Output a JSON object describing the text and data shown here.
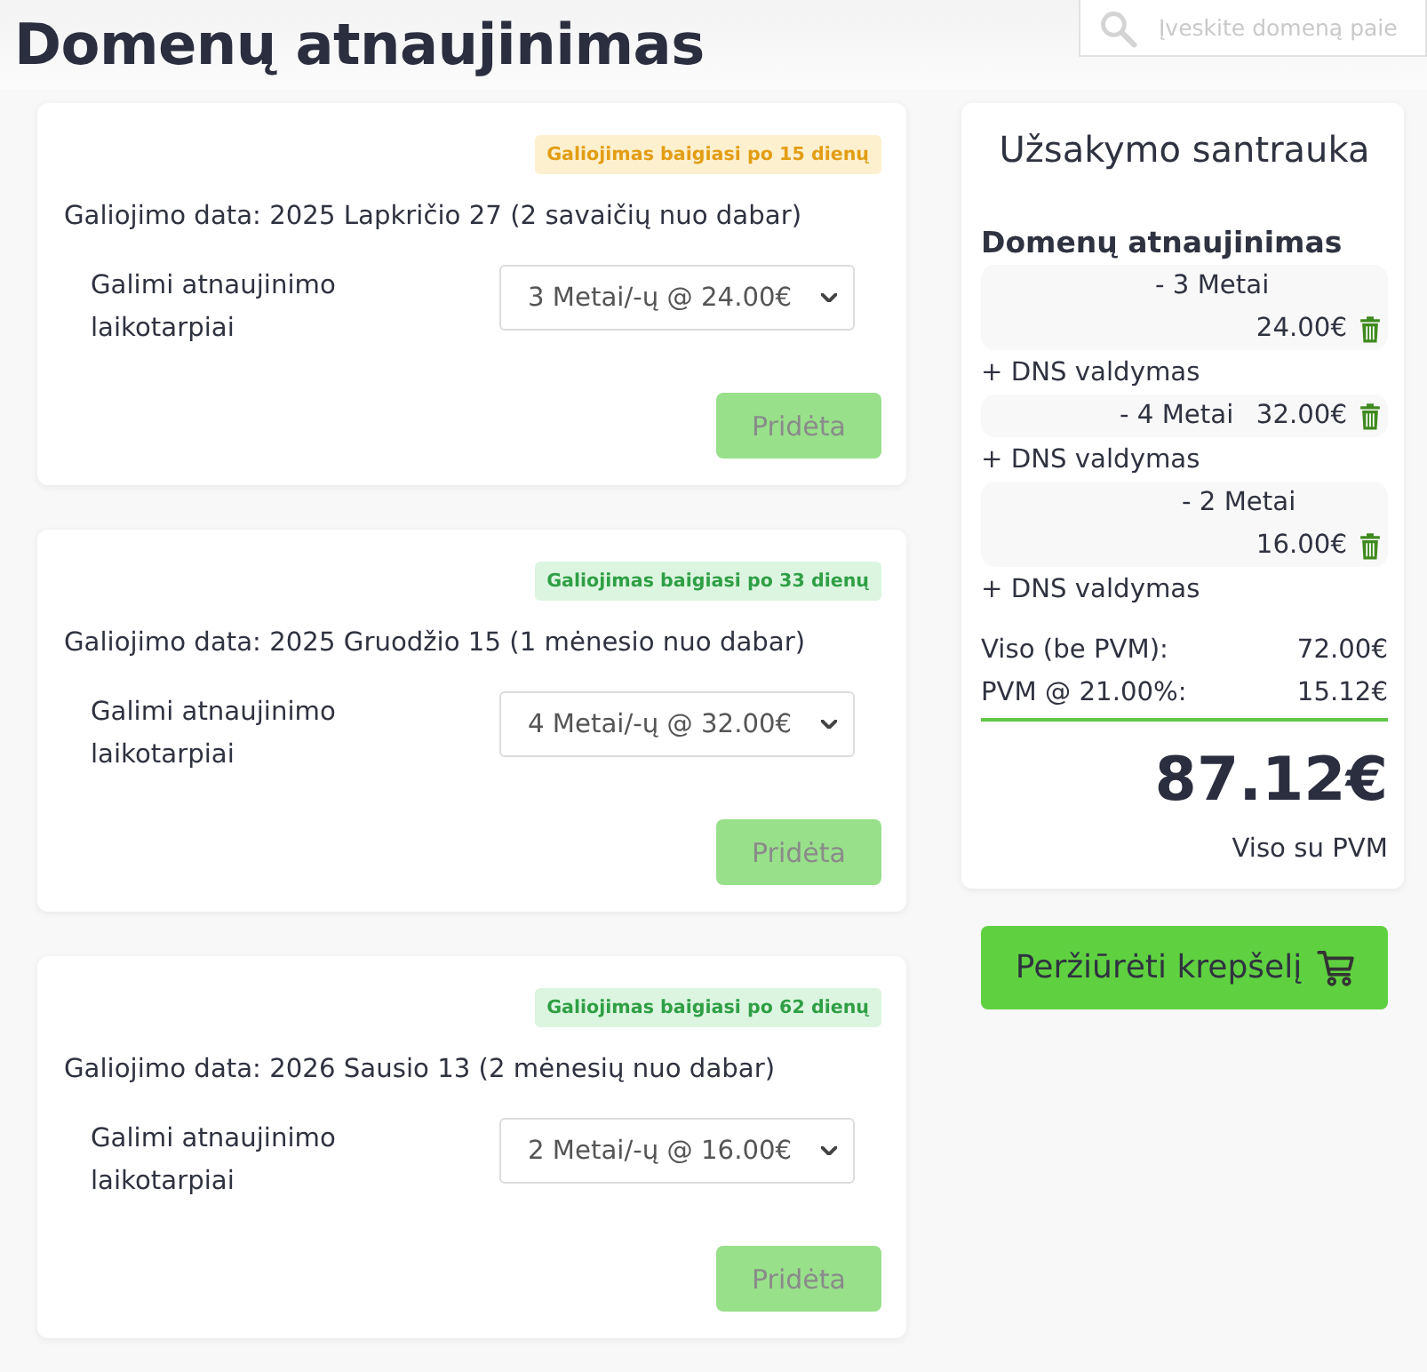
{
  "page": {
    "title": "Domenų atnaujinimas"
  },
  "search": {
    "placeholder": "Įveskite domeną paie"
  },
  "renewals": [
    {
      "badge": {
        "text": "Galiojimas baigiasi po 15 dienų",
        "kind": "warning"
      },
      "expiry": "Galiojimo data: 2025 Lapkričio 27 (2 savaičių nuo dabar)",
      "period_label": "Galimi atnaujinimo laikotarpiai",
      "period": "3 Metai/-ų @ 24.00€",
      "button": {
        "label": "Pridėta",
        "disabled": true
      }
    },
    {
      "badge": {
        "text": "Galiojimas baigiasi po 33 dienų",
        "kind": "success"
      },
      "expiry": "Galiojimo data: 2025 Gruodžio 15 (1 mėnesio nuo dabar)",
      "period_label": "Galimi atnaujinimo laikotarpiai",
      "period": "4 Metai/-ų @ 32.00€",
      "button": {
        "label": "Pridėta",
        "disabled": true
      }
    },
    {
      "badge": {
        "text": "Galiojimas baigiasi po 62 dienų",
        "kind": "success"
      },
      "expiry": "Galiojimo data: 2026 Sausio 13 (2 mėnesių nuo dabar)",
      "period_label": "Galimi atnaujinimo laikotarpiai",
      "period": "2 Metai/-ų @ 16.00€",
      "button": {
        "label": "Pridėta",
        "disabled": true
      }
    }
  ],
  "summary": {
    "title": "Užsakymo santrauka",
    "section": "Domenų atnaujinimas",
    "items": [
      {
        "name": "- 3 Metai",
        "price": "24.00€",
        "addon": "+ DNS valdymas"
      },
      {
        "name": "- 4 Metai",
        "price": "32.00€",
        "addon": "+ DNS valdymas"
      },
      {
        "name": "- 2 Metai",
        "price": "16.00€",
        "addon": "+ DNS valdymas"
      }
    ],
    "totals": [
      {
        "label": "Viso (be PVM):",
        "value": "72.00€"
      },
      {
        "label": "PVM @ 21.00%:",
        "value": "15.12€"
      }
    ],
    "grand_total": "87.12€",
    "grand_total_label": "Viso su PVM"
  },
  "cart_button": {
    "label": "Peržiūrėti krepšelį"
  }
}
